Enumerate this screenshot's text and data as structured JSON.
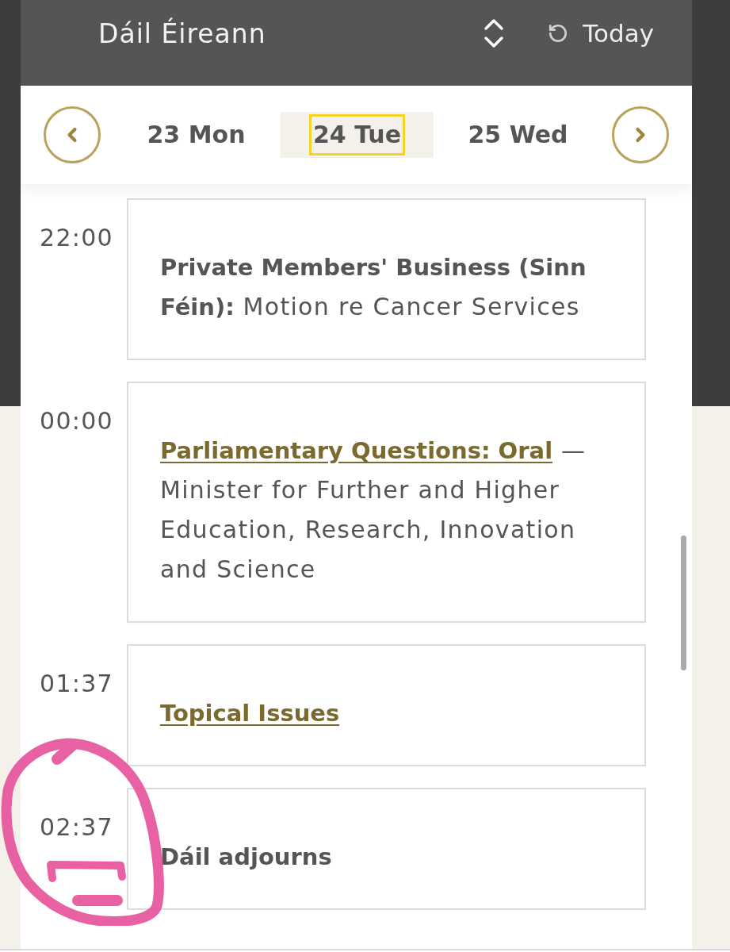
{
  "header": {
    "chamber": "Dáil Éireann",
    "today": "Today"
  },
  "days": [
    {
      "label": "23 Mon",
      "selected": false,
      "focused": false
    },
    {
      "label": "24 Tue",
      "selected": true,
      "focused": true
    },
    {
      "label": "25 Wed",
      "selected": false,
      "focused": false
    }
  ],
  "events": [
    {
      "time": "22:00",
      "kind": "text",
      "text": "**Private Members' Business (Sinn Féin):** Motion re Cancer Services",
      "highlighted": false
    },
    {
      "time": "00:00",
      "kind": "link",
      "link": "Parliamentary Questions: Oral",
      "text": "— Minister for Further and Higher Education, Research, Innovation and Science",
      "highlighted": false
    },
    {
      "time": "01:37",
      "kind": "link",
      "link": "Topical Issues",
      "highlighted": false
    },
    {
      "time": "02:37",
      "kind": "notice",
      "text": "Dáil adjourns",
      "highlighted": true
    }
  ]
}
